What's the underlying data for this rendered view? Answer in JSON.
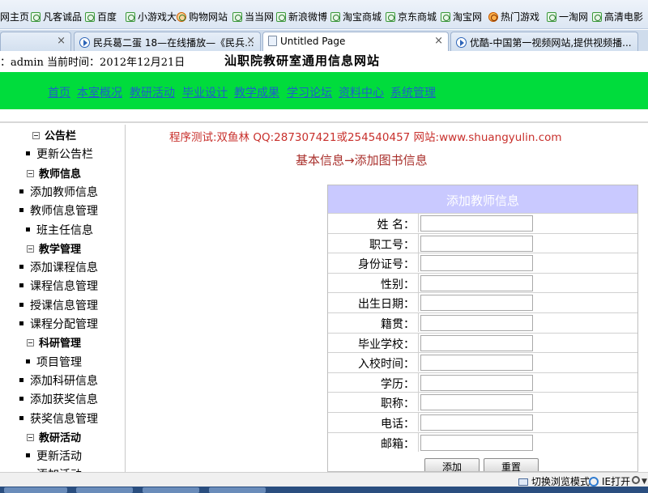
{
  "favorites": [
    {
      "label": "网主页",
      "icon": "page-icon"
    },
    {
      "label": "凡客诚品",
      "icon": "page-icon"
    },
    {
      "label": "百度",
      "icon": "page-icon"
    },
    {
      "label": "小游戏大",
      "icon": "page-icon"
    },
    {
      "label": "购物网站",
      "icon": "shopping-icon"
    },
    {
      "label": "当当网",
      "icon": "page-icon"
    },
    {
      "label": "新浪微博",
      "icon": "page-icon"
    },
    {
      "label": "淘宝商城",
      "icon": "page-icon"
    },
    {
      "label": "京东商城",
      "icon": "page-icon"
    },
    {
      "label": "淘宝网",
      "icon": "page-icon"
    },
    {
      "label": "热门游戏",
      "icon": "game-icon"
    },
    {
      "label": "一淘网",
      "icon": "page-icon"
    },
    {
      "label": "高清电影",
      "icon": "page-icon"
    }
  ],
  "tabs": [
    {
      "label": "",
      "close": "×"
    },
    {
      "label": "民兵葛二蛋 18—在线播放—《民兵...",
      "close": "×"
    },
    {
      "label": "Untitled Page",
      "close": "×"
    },
    {
      "label": "优酷-中国第一视频网站,提供视频播...",
      "close": ""
    }
  ],
  "header": {
    "user_info": "：admin  当前时间：2012年12月21日",
    "site_title": "汕职院教研室通用信息网站"
  },
  "nav": [
    "首页",
    "本室概况",
    "教研活动",
    "毕业设计",
    "教学成果",
    "学习论坛",
    "资料中心",
    "系统管理"
  ],
  "sidebar": [
    {
      "type": "category",
      "label": "公告栏"
    },
    {
      "type": "item",
      "label": "更新公告栏"
    },
    {
      "type": "category",
      "label": "教师信息"
    },
    {
      "type": "item",
      "label": "添加教师信息"
    },
    {
      "type": "item",
      "label": "教师信息管理"
    },
    {
      "type": "item",
      "label": "班主任信息"
    },
    {
      "type": "category",
      "label": "教学管理"
    },
    {
      "type": "item",
      "label": "添加课程信息"
    },
    {
      "type": "item",
      "label": "课程信息管理"
    },
    {
      "type": "item",
      "label": "授课信息管理"
    },
    {
      "type": "item",
      "label": "课程分配管理"
    },
    {
      "type": "category",
      "label": "科研管理"
    },
    {
      "type": "item",
      "label": "项目管理"
    },
    {
      "type": "item",
      "label": "添加科研信息"
    },
    {
      "type": "item",
      "label": "添加获奖信息"
    },
    {
      "type": "item",
      "label": "获奖信息管理"
    },
    {
      "type": "category",
      "label": "教研活动"
    },
    {
      "type": "item",
      "label": "更新活动"
    },
    {
      "type": "item",
      "label": "添加活动"
    }
  ],
  "main": {
    "tester_line": "程序测试:双鱼林 QQ:287307421或254540457 网站:www.shuangyulin.com",
    "breadcrumb": "基本信息→添加图书信息"
  },
  "form": {
    "title": "添加教师信息",
    "fields": [
      {
        "label": "姓  名：",
        "value": ""
      },
      {
        "label": "职工号：",
        "value": ""
      },
      {
        "label": "身份证号：",
        "value": ""
      },
      {
        "label": "性别：",
        "value": ""
      },
      {
        "label": "出生日期：",
        "value": ""
      },
      {
        "label": "籍贯：",
        "value": ""
      },
      {
        "label": "毕业学校：",
        "value": ""
      },
      {
        "label": "入校时间：",
        "value": ""
      },
      {
        "label": "学历：",
        "value": ""
      },
      {
        "label": "职称：",
        "value": ""
      },
      {
        "label": "电话：",
        "value": ""
      },
      {
        "label": "邮箱：",
        "value": ""
      }
    ],
    "submit_label": "添加",
    "reset_label": "重置"
  },
  "status": {
    "compat_label": "切换浏览模式",
    "ie_label": "IE打开"
  }
}
